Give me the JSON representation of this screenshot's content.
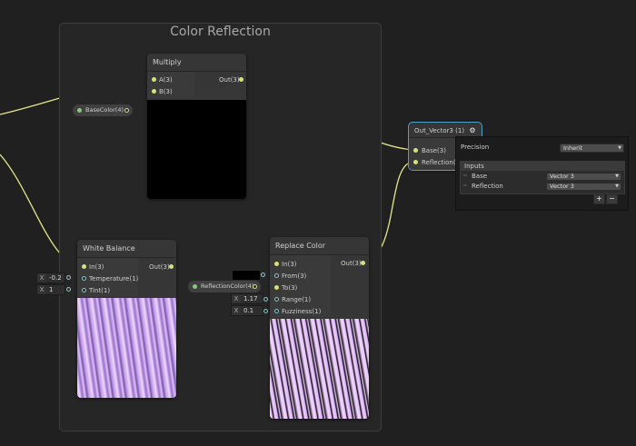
{
  "group": {
    "title": "Color Reflection"
  },
  "multiply": {
    "title": "Multiply",
    "inputs": [
      "A(3)",
      "B(3)"
    ],
    "output": "Out(3)"
  },
  "basecolor_property": {
    "label": "BaseColor(4)"
  },
  "white_balance": {
    "title": "White Balance",
    "inputs": [
      "In(3)",
      "Temperature(1)",
      "Tint(1)"
    ],
    "output": "Out(3)",
    "temperature_field": {
      "axis": "X",
      "value": "-0.2"
    },
    "tint_field": {
      "axis": "X",
      "value": "1"
    }
  },
  "replace_color": {
    "title": "Replace Color",
    "inputs": [
      "In(3)",
      "From(3)",
      "To(3)",
      "Range(1)",
      "Fuzziness(1)"
    ],
    "output": "Out(3)",
    "range_field": {
      "axis": "X",
      "value": "1.17"
    },
    "fuzziness_field": {
      "axis": "X",
      "value": "0.1"
    },
    "from_color": "#000000"
  },
  "reflectioncolor_property": {
    "label": "ReflectionColor(4)"
  },
  "out_node": {
    "title": "Out_Vector3 (1)",
    "inputs": [
      "Base(3)",
      "Reflection(3)"
    ]
  },
  "inspector": {
    "precision_label": "Precision",
    "precision_value": "Inherit",
    "inputs_header": "Inputs",
    "rows": [
      {
        "name": "Base",
        "type": "Vector 3"
      },
      {
        "name": "Reflection",
        "type": "Vector 3"
      }
    ],
    "add_label": "+",
    "remove_label": "−"
  },
  "colors": {
    "canvas": "#202020",
    "node": "#363636",
    "wire": "#e3e886",
    "port_vector": "#d6e27a",
    "port_float": "#8ec3c6",
    "selection": "#4aa3c9"
  },
  "icons": {
    "out_node_badge": "gear-icon"
  }
}
